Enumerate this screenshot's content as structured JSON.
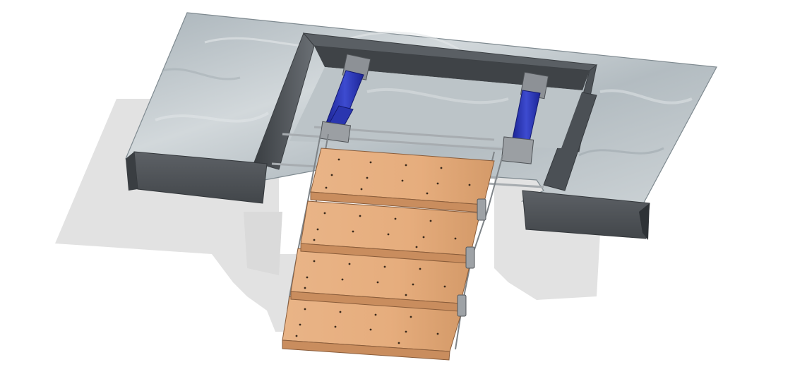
{
  "image": {
    "description_free": true
  },
  "colors": {
    "background": "#ffffff",
    "shadow": "#e3e3e3",
    "glass_light": "#c7ced2",
    "glass_dark": "#9ea9b0",
    "frame_dark": "#4a4e52",
    "frame_mid": "#6b7075",
    "actuator": "#2f3bb8",
    "actuator_dark": "#1a2390",
    "tread": "#e2a878",
    "tread_dark": "#c98d5e",
    "steel": "#8e9296",
    "rod": "#b8bcbf"
  },
  "treads": 4,
  "actuators": 2
}
